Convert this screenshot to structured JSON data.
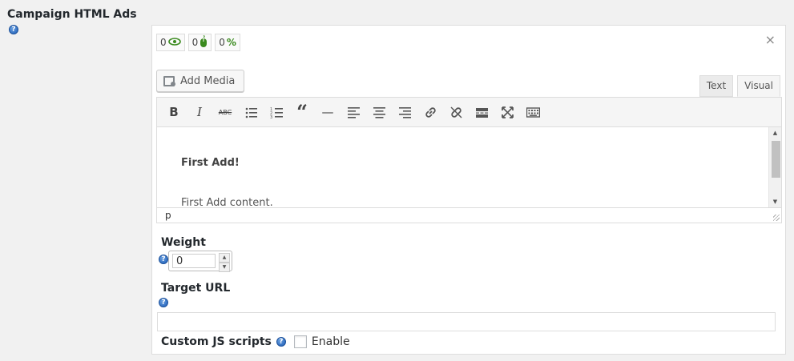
{
  "section": {
    "title": "Campaign HTML Ads",
    "help": "?"
  },
  "stats": [
    {
      "value": "0",
      "icon": "eye-icon",
      "glyph": "👁"
    },
    {
      "value": "0",
      "icon": "mouse-icon",
      "glyph": "🖱"
    },
    {
      "value": "0",
      "icon": "percent-icon",
      "glyph": "%"
    }
  ],
  "panel": {
    "close": "×"
  },
  "media": {
    "label": "Add Media"
  },
  "tabs": {
    "text": "Text",
    "visual": "Visual"
  },
  "toolbar": {
    "bold": "B",
    "italic": "I",
    "strike": "ABC",
    "blockquote": "“",
    "hr": "—"
  },
  "editor": {
    "heading": "First Add!",
    "paragraph": "First Add content.",
    "path": "p"
  },
  "weight": {
    "label": "Weight",
    "value": "0"
  },
  "target": {
    "label": "Target URL",
    "value": ""
  },
  "js": {
    "label": "Custom JS scripts",
    "enable": "Enable"
  }
}
